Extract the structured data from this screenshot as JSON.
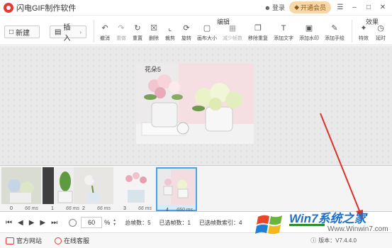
{
  "app": {
    "title": "闪电GIF制作软件",
    "login_label": "登录",
    "vip_label": "开通会员"
  },
  "toolbar": {
    "new_label": "新建",
    "insert_label": "插入",
    "group_edit_label": "编辑",
    "group_effect_label": "效果",
    "tools": [
      {
        "label": "撤消",
        "icon": "undo-icon",
        "enabled": true
      },
      {
        "label": "重做",
        "icon": "redo-icon",
        "enabled": false
      },
      {
        "label": "重置",
        "icon": "reset-icon",
        "enabled": true
      },
      {
        "label": "删除",
        "icon": "delete-icon",
        "enabled": true
      },
      {
        "label": "裁剪",
        "icon": "crop-icon",
        "enabled": true
      },
      {
        "label": "旋转",
        "icon": "rotate-icon",
        "enabled": true
      },
      {
        "label": "画布大小",
        "icon": "canvas-size-icon",
        "enabled": true
      },
      {
        "label": "减少帧数",
        "icon": "reduce-frames-icon",
        "enabled": false
      },
      {
        "label": "移除重复",
        "icon": "remove-duplicates-icon",
        "enabled": true
      },
      {
        "label": "添加文字",
        "icon": "add-text-icon",
        "enabled": true
      },
      {
        "label": "添加水印",
        "icon": "add-watermark-icon",
        "enabled": true
      },
      {
        "label": "添加手绘",
        "icon": "add-drawing-icon",
        "enabled": true
      }
    ],
    "effect_tools": [
      {
        "label": "特效",
        "icon": "effects-icon"
      },
      {
        "label": "延时",
        "icon": "delay-icon"
      }
    ]
  },
  "preview": {
    "frame_label": "花朵5"
  },
  "filmstrip": {
    "frames": [
      {
        "index": "0",
        "duration": "66 ms"
      },
      {
        "index": "1",
        "duration": "66 ms"
      },
      {
        "index": "2",
        "duration": "66 ms"
      },
      {
        "index": "3",
        "duration": "66 ms"
      },
      {
        "index": "4",
        "duration": "650 ms"
      }
    ],
    "selected_index": 4
  },
  "controls": {
    "zoom_value": "60",
    "zoom_unit": "%",
    "total_frames_label": "总帧数：",
    "total_frames_value": "5",
    "selected_frames_label": "已选帧数：",
    "selected_frames_value": "1",
    "selected_index_label": "已选帧数索引：",
    "selected_index_value": "4"
  },
  "footer": {
    "website_label": "官方网站",
    "support_label": "在线客服",
    "version_label": "版本：V7.4.4.0"
  },
  "watermark": {
    "brand": "Win7系统之家",
    "url": "Www.Winwin7.com"
  },
  "colors": {
    "accent_red": "#e8382f",
    "selected_frame": "#4aa3e0",
    "vip_bg": "#f6d7a8"
  }
}
